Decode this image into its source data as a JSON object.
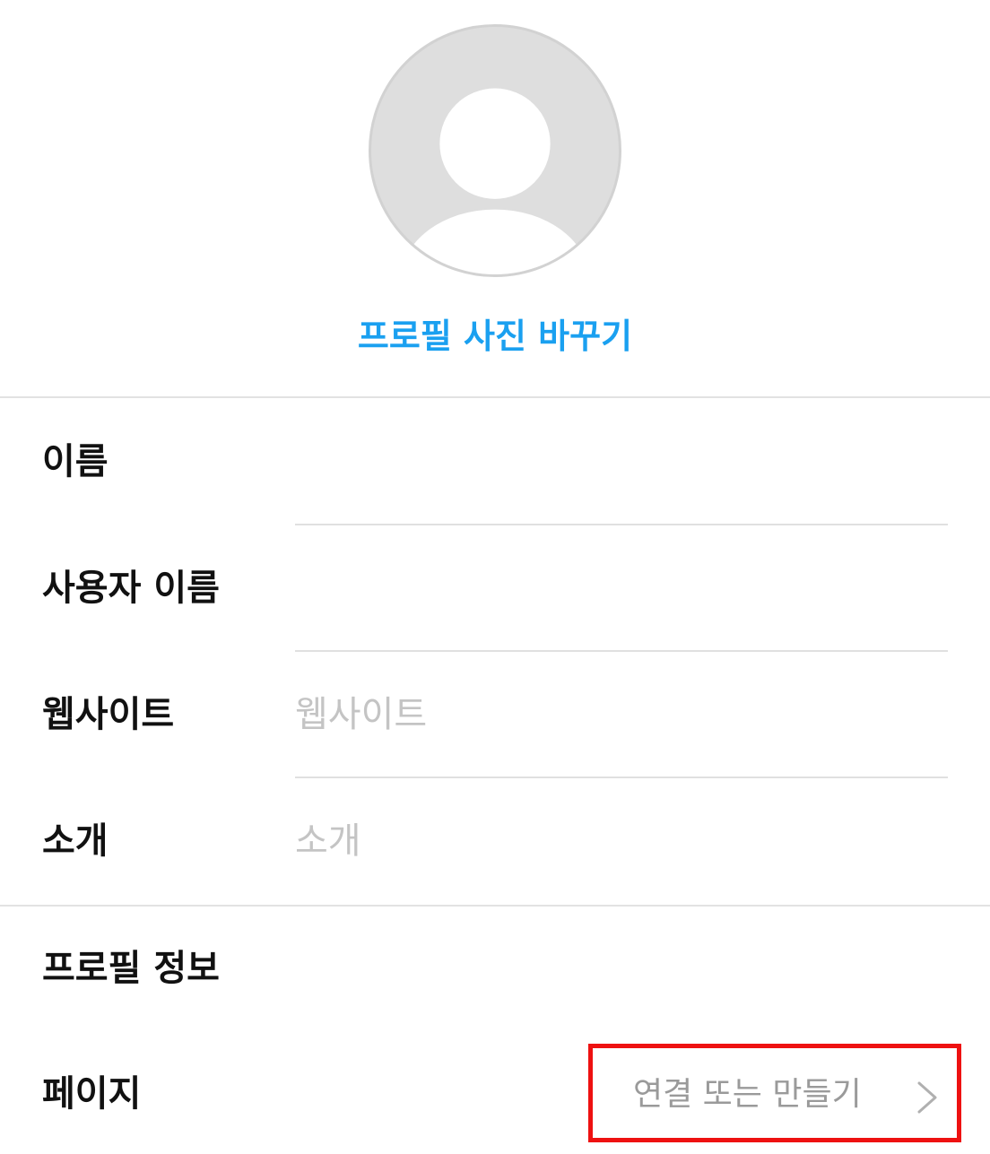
{
  "profile": {
    "change_photo_label": "프로필 사진 바꾸기"
  },
  "fields": {
    "name": {
      "label": "이름",
      "value": "",
      "placeholder": ""
    },
    "username": {
      "label": "사용자 이름",
      "value": "",
      "placeholder": ""
    },
    "website": {
      "label": "웹사이트",
      "value": "",
      "placeholder": "웹사이트"
    },
    "bio": {
      "label": "소개",
      "value": "",
      "placeholder": "소개"
    }
  },
  "profile_info": {
    "section_title": "프로필 정보",
    "page": {
      "label": "페이지",
      "action_label": "연결 또는 만들기",
      "action_icon": "chevron-right-icon"
    }
  },
  "colors": {
    "accent": "#1aa0f0",
    "placeholder": "#c4c4c4",
    "highlight_border": "#ee1111"
  }
}
